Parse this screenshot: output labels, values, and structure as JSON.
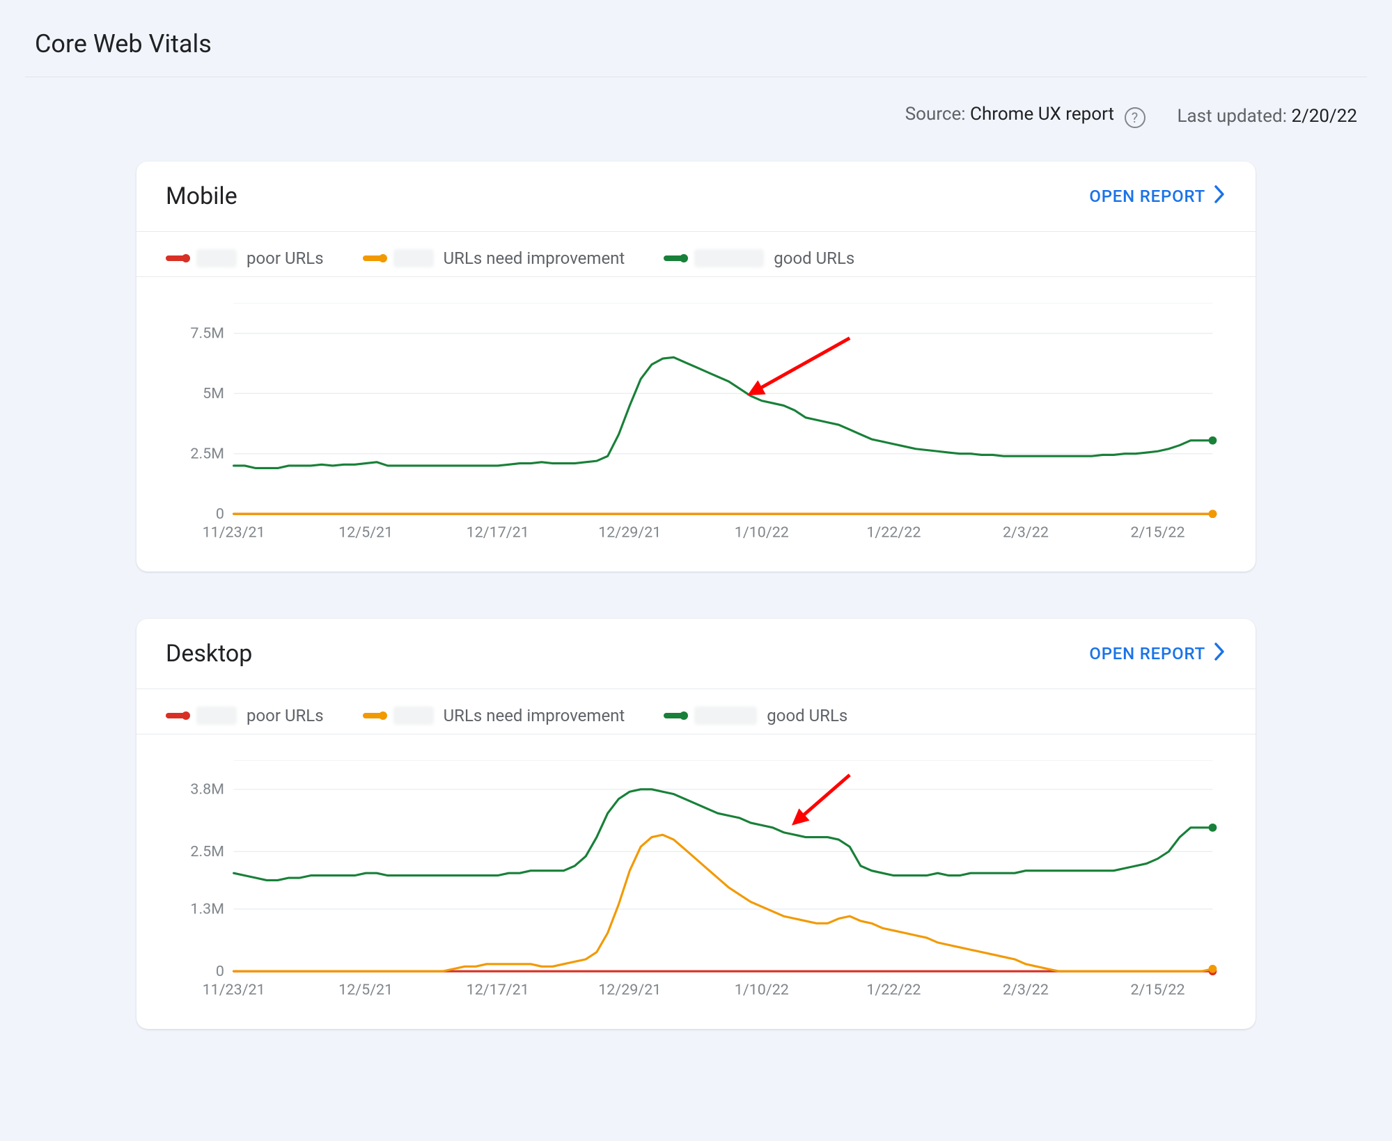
{
  "page": {
    "title": "Core Web Vitals"
  },
  "meta": {
    "source_label": "Source: ",
    "source_value": "Chrome UX report",
    "updated_label": "Last updated: ",
    "updated_value": "2/20/22"
  },
  "open_report_label": "OPEN REPORT",
  "cards": {
    "mobile": {
      "title": "Mobile",
      "legend": {
        "poor": "poor URLs",
        "need": "URLs need improvement",
        "good": "good URLs"
      }
    },
    "desktop": {
      "title": "Desktop",
      "legend": {
        "poor": "poor URLs",
        "need": "URLs need improvement",
        "good": "good URLs"
      }
    }
  },
  "colors": {
    "poor": "#d93025",
    "need": "#f29900",
    "good": "#188038"
  },
  "chart_data": [
    {
      "id": "mobile",
      "type": "line",
      "title": "Mobile",
      "xlabel": "",
      "ylabel": "",
      "x_tick_labels": [
        "11/23/21",
        "12/5/21",
        "12/17/21",
        "12/29/21",
        "1/10/22",
        "1/22/22",
        "2/3/22",
        "2/15/22"
      ],
      "x_tick_positions_days": [
        0,
        12,
        24,
        36,
        48,
        60,
        72,
        84
      ],
      "x_range_days": [
        0,
        89
      ],
      "ylim": [
        0,
        8750000
      ],
      "y_tick_values": [
        0,
        2500000,
        5000000,
        7500000
      ],
      "y_tick_labels": [
        "0",
        "2.5M",
        "5M",
        "7.5M"
      ],
      "series": [
        {
          "name": "poor URLs",
          "color": "#d93025",
          "values": [
            0,
            0,
            0,
            0,
            0,
            0,
            0,
            0,
            0,
            0,
            0,
            0,
            0,
            0,
            0,
            0,
            0,
            0,
            0,
            0,
            0,
            0,
            0,
            0,
            0,
            0,
            0,
            0,
            0,
            0,
            0,
            0,
            0,
            0,
            0,
            0,
            0,
            0,
            0,
            0,
            0,
            0,
            0,
            0,
            0,
            0,
            0,
            0,
            0,
            0,
            0,
            0,
            0,
            0,
            0,
            0,
            0,
            0,
            0,
            0,
            0,
            0,
            0,
            0,
            0,
            0,
            0,
            0,
            0,
            0,
            0,
            0,
            0,
            0,
            0,
            0,
            0,
            0,
            0,
            0,
            0,
            0,
            0,
            0,
            0,
            0,
            0,
            0,
            0,
            0
          ]
        },
        {
          "name": "URLs need improvement",
          "color": "#f29900",
          "values": [
            0,
            0,
            0,
            0,
            0,
            0,
            0,
            0,
            0,
            0,
            0,
            0,
            0,
            0,
            0,
            0,
            0,
            0,
            0,
            0,
            0,
            0,
            0,
            0,
            0,
            0,
            0,
            0,
            0,
            0,
            0,
            0,
            0,
            0,
            0,
            0,
            0,
            0,
            0,
            0,
            0,
            0,
            0,
            0,
            0,
            0,
            0,
            0,
            0,
            0,
            0,
            0,
            0,
            0,
            0,
            0,
            0,
            0,
            0,
            0,
            0,
            0,
            0,
            0,
            0,
            0,
            0,
            0,
            0,
            0,
            0,
            0,
            0,
            0,
            0,
            0,
            0,
            0,
            0,
            0,
            0,
            0,
            0,
            0,
            0,
            0,
            0,
            0,
            0,
            0
          ]
        },
        {
          "name": "good URLs",
          "color": "#188038",
          "values": [
            2000000,
            2000000,
            1900000,
            1900000,
            1900000,
            2000000,
            2000000,
            2000000,
            2050000,
            2000000,
            2050000,
            2050000,
            2100000,
            2150000,
            2000000,
            2000000,
            2000000,
            2000000,
            2000000,
            2000000,
            2000000,
            2000000,
            2000000,
            2000000,
            2000000,
            2050000,
            2100000,
            2100000,
            2150000,
            2100000,
            2100000,
            2100000,
            2150000,
            2200000,
            2400000,
            3300000,
            4500000,
            5600000,
            6200000,
            6450000,
            6500000,
            6300000,
            6100000,
            5900000,
            5700000,
            5500000,
            5200000,
            4900000,
            4700000,
            4600000,
            4500000,
            4300000,
            4000000,
            3900000,
            3800000,
            3700000,
            3500000,
            3300000,
            3100000,
            3000000,
            2900000,
            2800000,
            2700000,
            2650000,
            2600000,
            2550000,
            2500000,
            2500000,
            2450000,
            2450000,
            2400000,
            2400000,
            2400000,
            2400000,
            2400000,
            2400000,
            2400000,
            2400000,
            2400000,
            2450000,
            2450000,
            2500000,
            2500000,
            2550000,
            2600000,
            2700000,
            2850000,
            3050000,
            3050000,
            3050000
          ]
        }
      ],
      "annotation_arrow": {
        "from_day": 56,
        "from_value": 7300000,
        "to_day": 47,
        "to_value": 5000000
      }
    },
    {
      "id": "desktop",
      "type": "line",
      "title": "Desktop",
      "xlabel": "",
      "ylabel": "",
      "x_tick_labels": [
        "11/23/21",
        "12/5/21",
        "12/17/21",
        "12/29/21",
        "1/10/22",
        "1/22/22",
        "2/3/22",
        "2/15/22"
      ],
      "x_tick_positions_days": [
        0,
        12,
        24,
        36,
        48,
        60,
        72,
        84
      ],
      "x_range_days": [
        0,
        89
      ],
      "ylim": [
        0,
        4400000
      ],
      "y_tick_values": [
        0,
        1300000,
        2500000,
        3800000
      ],
      "y_tick_labels": [
        "0",
        "1.3M",
        "2.5M",
        "3.8M"
      ],
      "series": [
        {
          "name": "poor URLs",
          "color": "#d93025",
          "values": [
            0,
            0,
            0,
            0,
            0,
            0,
            0,
            0,
            0,
            0,
            0,
            0,
            0,
            0,
            0,
            0,
            0,
            0,
            0,
            0,
            0,
            0,
            0,
            0,
            0,
            0,
            0,
            0,
            0,
            0,
            0,
            0,
            0,
            0,
            0,
            0,
            0,
            0,
            0,
            0,
            0,
            0,
            0,
            0,
            0,
            0,
            0,
            0,
            0,
            0,
            0,
            0,
            0,
            0,
            0,
            0,
            0,
            0,
            0,
            0,
            0,
            0,
            0,
            0,
            0,
            0,
            0,
            0,
            0,
            0,
            0,
            0,
            0,
            0,
            0,
            0,
            0,
            0,
            0,
            0,
            0,
            0,
            0,
            0,
            0,
            0,
            0,
            0,
            0,
            0
          ]
        },
        {
          "name": "URLs need improvement",
          "color": "#f29900",
          "values": [
            0,
            0,
            0,
            0,
            0,
            0,
            0,
            0,
            0,
            0,
            0,
            0,
            0,
            0,
            0,
            0,
            0,
            0,
            0,
            0,
            50000,
            100000,
            100000,
            150000,
            150000,
            150000,
            150000,
            150000,
            100000,
            100000,
            150000,
            200000,
            250000,
            400000,
            800000,
            1400000,
            2100000,
            2600000,
            2800000,
            2850000,
            2750000,
            2550000,
            2350000,
            2150000,
            1950000,
            1750000,
            1600000,
            1450000,
            1350000,
            1250000,
            1150000,
            1100000,
            1050000,
            1000000,
            1000000,
            1100000,
            1150000,
            1050000,
            1000000,
            900000,
            850000,
            800000,
            750000,
            700000,
            600000,
            550000,
            500000,
            450000,
            400000,
            350000,
            300000,
            250000,
            150000,
            100000,
            50000,
            0,
            0,
            0,
            0,
            0,
            0,
            0,
            0,
            0,
            0,
            0,
            0,
            0,
            0,
            50000
          ]
        },
        {
          "name": "good URLs",
          "color": "#188038",
          "values": [
            2050000,
            2000000,
            1950000,
            1900000,
            1900000,
            1950000,
            1950000,
            2000000,
            2000000,
            2000000,
            2000000,
            2000000,
            2050000,
            2050000,
            2000000,
            2000000,
            2000000,
            2000000,
            2000000,
            2000000,
            2000000,
            2000000,
            2000000,
            2000000,
            2000000,
            2050000,
            2050000,
            2100000,
            2100000,
            2100000,
            2100000,
            2200000,
            2400000,
            2800000,
            3300000,
            3600000,
            3750000,
            3800000,
            3800000,
            3750000,
            3700000,
            3600000,
            3500000,
            3400000,
            3300000,
            3250000,
            3200000,
            3100000,
            3050000,
            3000000,
            2900000,
            2850000,
            2800000,
            2800000,
            2800000,
            2750000,
            2600000,
            2200000,
            2100000,
            2050000,
            2000000,
            2000000,
            2000000,
            2000000,
            2050000,
            2000000,
            2000000,
            2050000,
            2050000,
            2050000,
            2050000,
            2050000,
            2100000,
            2100000,
            2100000,
            2100000,
            2100000,
            2100000,
            2100000,
            2100000,
            2100000,
            2150000,
            2200000,
            2250000,
            2350000,
            2500000,
            2800000,
            3000000,
            3000000,
            3000000
          ]
        }
      ],
      "annotation_arrow": {
        "from_day": 56,
        "from_value": 4100000,
        "to_day": 51,
        "to_value": 3100000
      }
    }
  ]
}
